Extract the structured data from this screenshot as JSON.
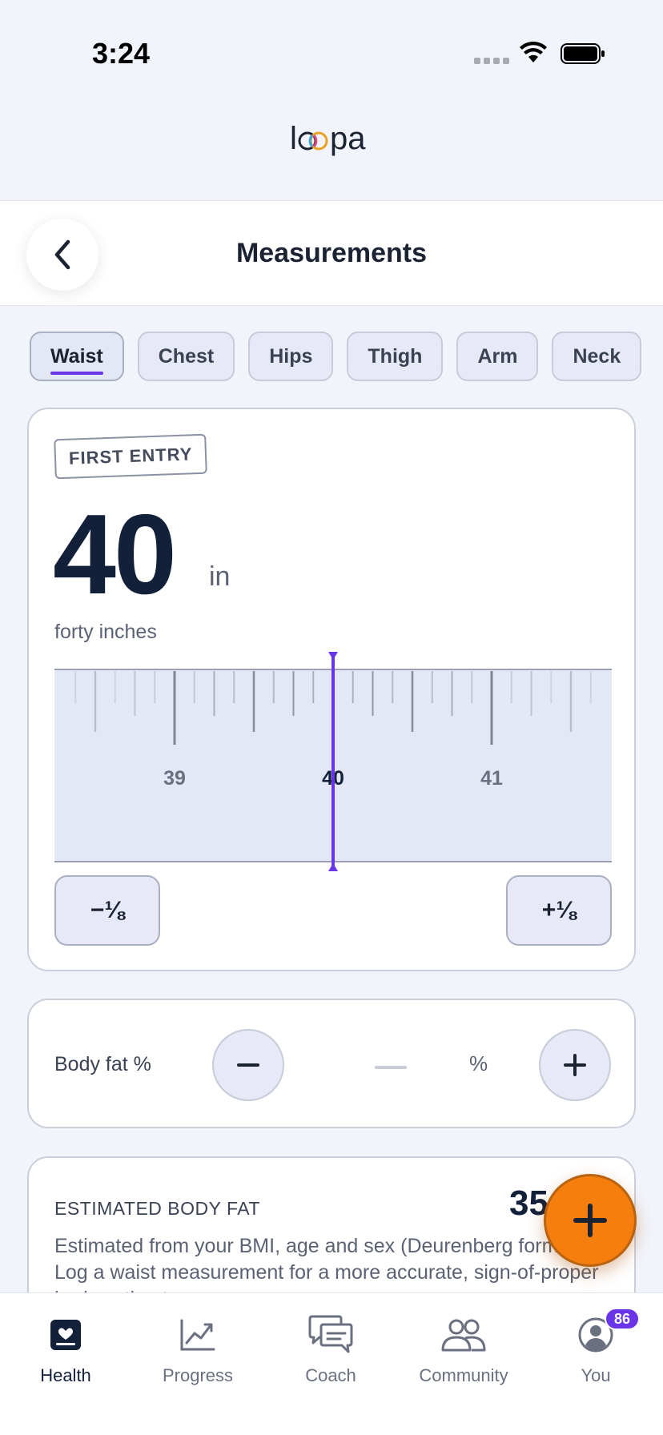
{
  "status_bar": {
    "time": "3:24"
  },
  "brand": {
    "name": "loopa"
  },
  "header": {
    "title": "Measurements"
  },
  "tabs": [
    {
      "label": "Waist",
      "active": true
    },
    {
      "label": "Chest",
      "active": false
    },
    {
      "label": "Hips",
      "active": false
    },
    {
      "label": "Thigh",
      "active": false
    },
    {
      "label": "Arm",
      "active": false
    },
    {
      "label": "Neck",
      "active": false
    }
  ],
  "measurement": {
    "badge": "FIRST ENTRY",
    "value": "40",
    "unit": "in",
    "words": "forty inches",
    "ruler": {
      "labels": [
        "39",
        "40",
        "41"
      ],
      "selected": 40,
      "min": 38,
      "max": 42,
      "step": 0.125
    },
    "decrement_label": "−⅛",
    "increment_label": "+⅛"
  },
  "body_fat": {
    "label": "Body fat %",
    "value": "",
    "unit": "%"
  },
  "estimated": {
    "title": "ESTIMATED BODY FAT",
    "value": "35",
    "description": "Estimated from your BMI, age and sex (Deurenberg formula). Log a waist measurement for a more accurate, sign-of-proper body estimate."
  },
  "bottom_nav": [
    {
      "label": "Health",
      "icon": "health-icon",
      "active": true
    },
    {
      "label": "Progress",
      "icon": "progress-chart-icon",
      "active": false
    },
    {
      "label": "Coach",
      "icon": "chat-bubbles-icon",
      "active": false
    },
    {
      "label": "Community",
      "icon": "people-icon",
      "active": false
    },
    {
      "label": "You",
      "icon": "profile-icon",
      "active": false,
      "badge": "86"
    }
  ],
  "colors": {
    "accent": "#6A35E8",
    "fab": "#F57E0E",
    "navy": "#13203A"
  }
}
